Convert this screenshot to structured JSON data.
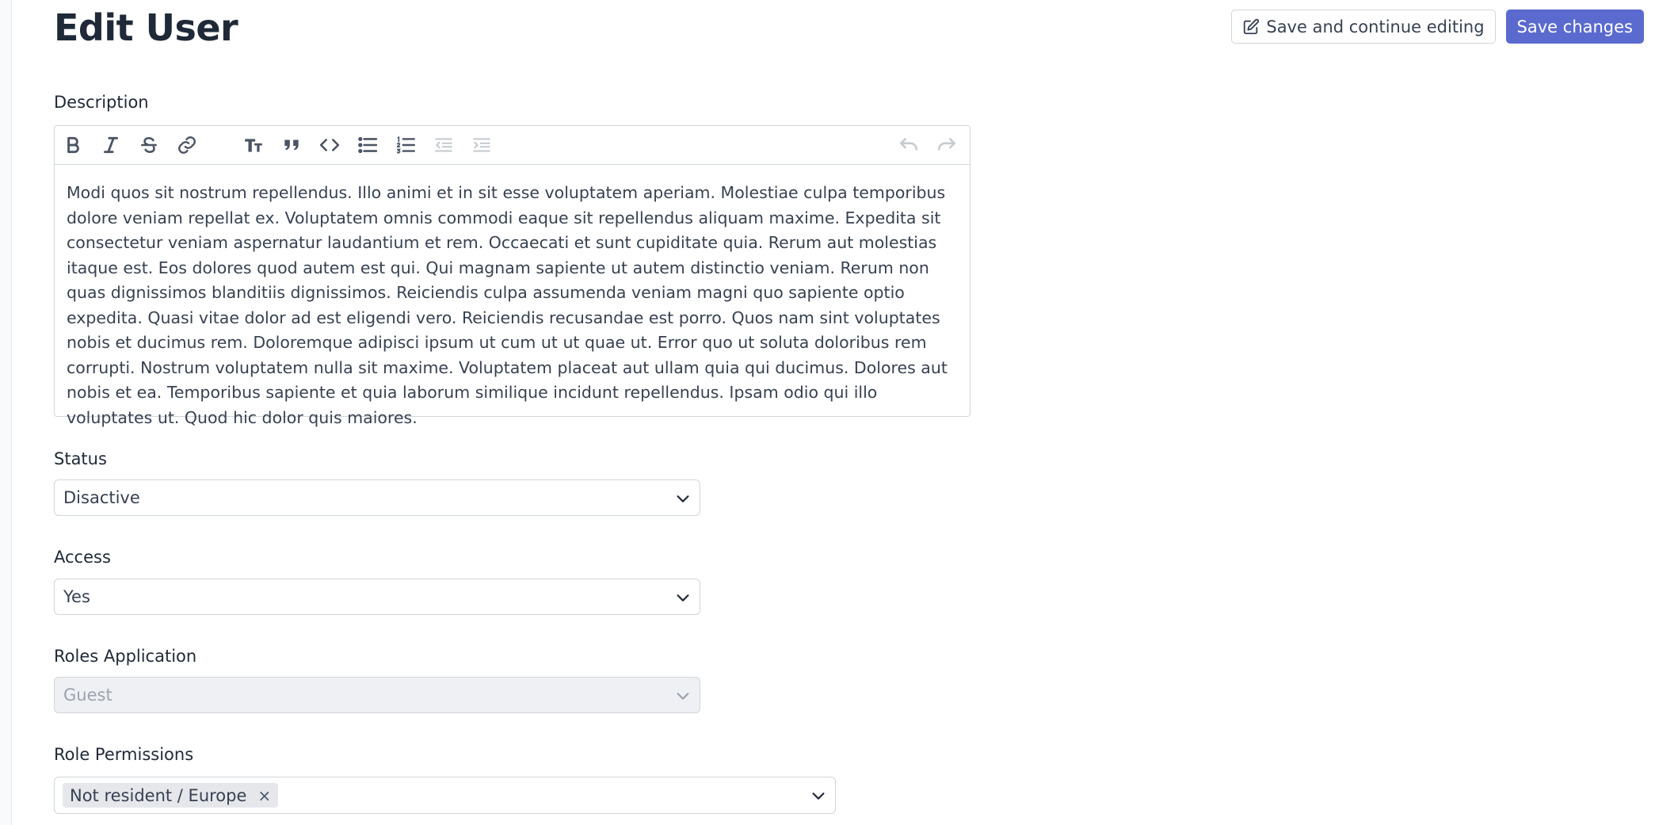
{
  "header": {
    "title": "Edit User",
    "save_continue_label": "Save and continue editing",
    "save_label": "Save changes"
  },
  "description": {
    "label": "Description",
    "toolbar": [
      "bold-icon",
      "italic-icon",
      "strikethrough-icon",
      "link-icon",
      "heading-icon",
      "quote-icon",
      "code-icon",
      "bullet-list-icon",
      "numbered-list-icon",
      "outdent-icon",
      "indent-icon",
      "undo-icon",
      "redo-icon"
    ],
    "content": "Modi quos sit nostrum repellendus. Illo animi et in sit esse voluptatem aperiam. Molestiae culpa temporibus dolore veniam repellat ex. Voluptatem omnis commodi eaque sit repellendus aliquam maxime. Expedita sit consectetur veniam aspernatur laudantium et rem. Occaecati et sunt cupiditate quia. Rerum aut molestias itaque est. Eos dolores quod autem est qui. Qui magnam sapiente ut autem distinctio veniam. Rerum non quas dignissimos blanditiis dignissimos. Reiciendis culpa assumenda veniam magni quo sapiente optio expedita. Quasi vitae dolor ad est eligendi vero. Reiciendis recusandae est porro. Quos nam sint voluptates nobis et ducimus rem. Doloremque adipisci ipsum ut cum ut ut quae ut. Error quo ut soluta doloribus rem corrupti. Nostrum voluptatem nulla sit maxime. Voluptatem placeat aut ullam quia qui ducimus. Dolores aut nobis et ea. Temporibus sapiente et quia laborum similique incidunt repellendus. Ipsam odio qui illo voluptates ut. Quod hic dolor quis maiores."
  },
  "status": {
    "label": "Status",
    "value": "Disactive"
  },
  "access": {
    "label": "Access",
    "value": "Yes"
  },
  "roles_application": {
    "label": "Roles Application",
    "value": "Guest"
  },
  "role_permissions": {
    "label": "Role Permissions",
    "tags": [
      "Not resident / Europe"
    ],
    "remove_glyph": "×"
  },
  "colors": {
    "primary": "#5a6acf",
    "border": "#d1d5db",
    "disabled_bg": "#eef0f3"
  }
}
